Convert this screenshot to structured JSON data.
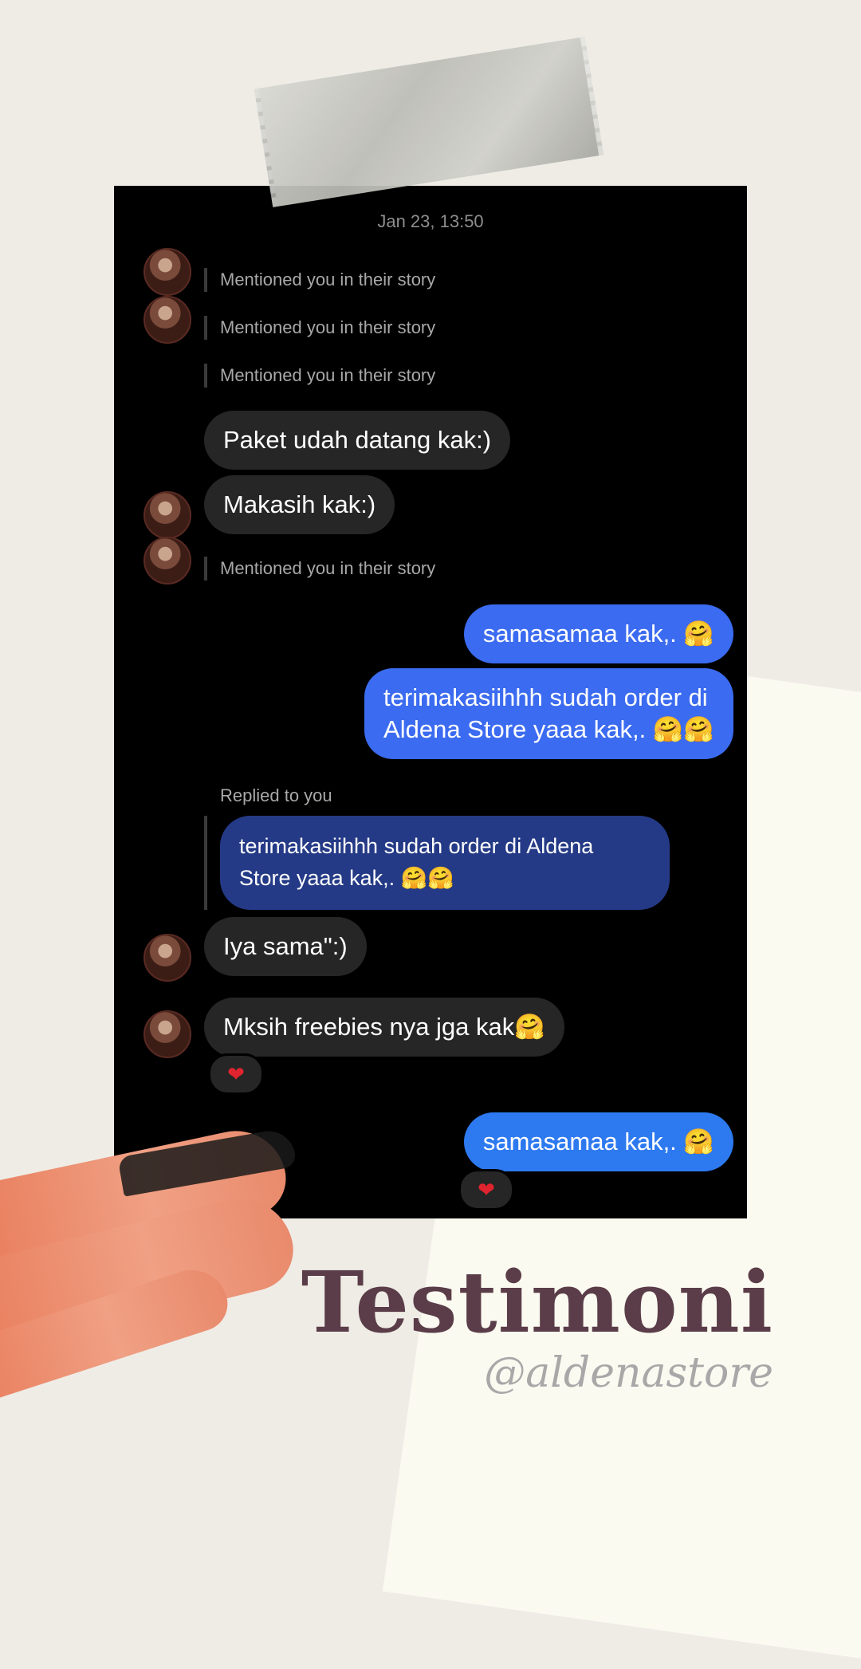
{
  "chat": {
    "timestamp": "Jan 23, 13:50",
    "mention_1": "Mentioned you in their story",
    "mention_2": "Mentioned you in their story",
    "mention_3": "Mentioned you in their story",
    "msg_paket": "Paket udah datang kak:)",
    "msg_makasih": "Makasih kak:)",
    "mention_4": "Mentioned you in their story",
    "reply_1": "samasamaa kak,. 🤗",
    "reply_2_line1": "terimakasiihhh sudah order di",
    "reply_2_line2": "Aldena Store yaaa kak,. 🤗🤗",
    "replied_label": "Replied to you",
    "quoted_line1": "terimakasiihhh sudah order di Aldena",
    "quoted_line2": "Store yaaa kak,. 🤗🤗",
    "msg_iya": "Iya sama\":)",
    "msg_freebies": "Mksih freebies nya jga kak🤗",
    "reaction_1": "❤",
    "reply_3": "samasamaa kak,. 🤗",
    "reaction_2": "❤"
  },
  "caption": {
    "title": "Testimoni",
    "handle": "@aldenastore"
  },
  "colors": {
    "background": "#efece6",
    "title": "#5a3d48",
    "accent_orange": "#e9805f",
    "bubble_blue": "#3b6bf0"
  }
}
